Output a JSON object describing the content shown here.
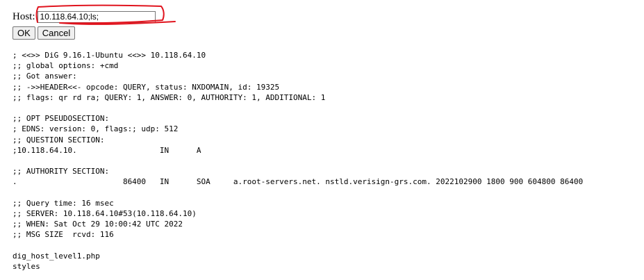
{
  "form": {
    "host_label": "Host:",
    "host_value": "10.118.64.10;ls;",
    "ok_label": "OK",
    "cancel_label": "Cancel"
  },
  "output_lines": [
    "; <<>> DiG 9.16.1-Ubuntu <<>> 10.118.64.10",
    ";; global options: +cmd",
    ";; Got answer:",
    ";; ->>HEADER<<- opcode: QUERY, status: NXDOMAIN, id: 19325",
    ";; flags: qr rd ra; QUERY: 1, ANSWER: 0, AUTHORITY: 1, ADDITIONAL: 1",
    "",
    ";; OPT PSEUDOSECTION:",
    "; EDNS: version: 0, flags:; udp: 512",
    ";; QUESTION SECTION:",
    ";10.118.64.10.                  IN      A",
    "",
    ";; AUTHORITY SECTION:",
    ".                       86400   IN      SOA     a.root-servers.net. nstld.verisign-grs.com. 2022102900 1800 900 604800 86400",
    "",
    ";; Query time: 16 msec",
    ";; SERVER: 10.118.64.10#53(10.118.64.10)",
    ";; WHEN: Sat Oct 29 10:00:42 UTC 2022",
    ";; MSG SIZE  rcvd: 116",
    "",
    "dig_host_level1.php",
    "styles"
  ],
  "colors": {
    "annotation": "#e0141e"
  }
}
